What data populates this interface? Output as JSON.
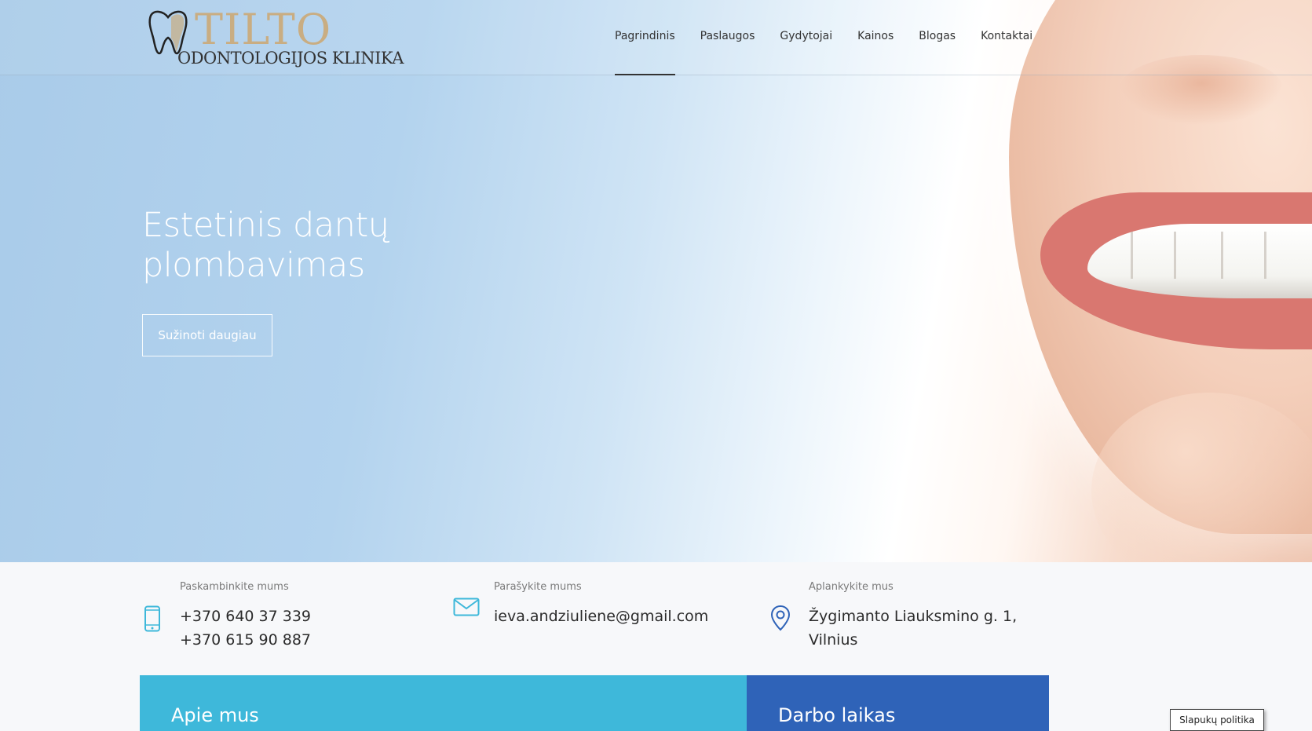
{
  "logo": {
    "word": "TILTO",
    "subtitle": "ODONTOLOGIJOS KLINIKA"
  },
  "nav": {
    "items": [
      {
        "label": "Pagrindinis",
        "active": true
      },
      {
        "label": "Paslaugos",
        "active": false
      },
      {
        "label": "Gydytojai",
        "active": false
      },
      {
        "label": "Kainos",
        "active": false
      },
      {
        "label": "Blogas",
        "active": false
      },
      {
        "label": "Kontaktai",
        "active": false
      }
    ]
  },
  "hero": {
    "title_line1": "Estetinis dantų",
    "title_line2": "plombavimas",
    "button_label": "Sužinoti daugiau"
  },
  "contact": {
    "phone": {
      "label": "Paskambinkite mums",
      "line1": "+370 640 37 339",
      "line2": "+370 615 90 887",
      "icon": "phone-icon"
    },
    "email": {
      "label": "Parašykite mums",
      "value": "ieva.andziuliene@gmail.com",
      "icon": "mail-icon"
    },
    "address": {
      "label": "Aplankykite mus",
      "line1": "Žygimanto Liauksmino g. 1,",
      "line2": "Vilnius",
      "icon": "location-pin-icon"
    }
  },
  "panels": {
    "about_title": "Apie mus",
    "hours_title": "Darbo laikas"
  },
  "cookie": {
    "label": "Slapukų politika"
  },
  "colors": {
    "accent_light": "#3eb8da",
    "accent_dark": "#2f63b8",
    "logo_gold": "#c9ad82"
  }
}
